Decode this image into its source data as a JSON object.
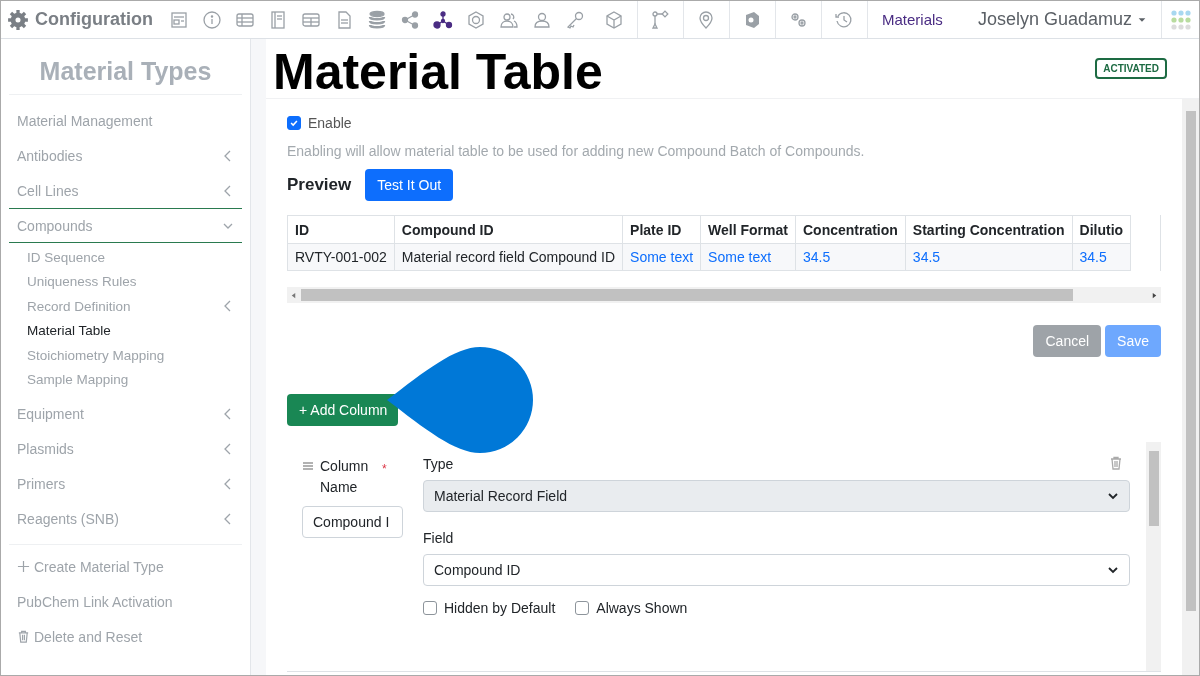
{
  "topbar": {
    "title": "Configuration",
    "icons": [
      {
        "kind": "form",
        "selected": false
      },
      {
        "kind": "info",
        "selected": false
      },
      {
        "kind": "table",
        "selected": false
      },
      {
        "kind": "book",
        "selected": false
      },
      {
        "kind": "grid",
        "selected": false
      },
      {
        "kind": "document",
        "selected": false
      },
      {
        "kind": "database",
        "selected": false
      },
      {
        "kind": "share",
        "selected": false
      },
      {
        "kind": "network",
        "selected": true
      },
      {
        "kind": "hexagon",
        "selected": false
      },
      {
        "kind": "users",
        "selected": false
      },
      {
        "kind": "user",
        "selected": false
      },
      {
        "kind": "key",
        "selected": false
      },
      {
        "kind": "cube",
        "selected": false
      },
      {
        "kind": "branch",
        "selected": false
      },
      {
        "kind": "pin",
        "selected": false
      },
      {
        "kind": "shield",
        "selected": false
      },
      {
        "kind": "gears",
        "selected": false
      },
      {
        "kind": "history",
        "selected": false
      }
    ],
    "link": "Materials",
    "user": "Joselyn Guadamuz"
  },
  "sidebar": {
    "title": "Material Types",
    "items": [
      {
        "label": "Material Management",
        "kind": "link"
      },
      {
        "label": "Antibodies",
        "kind": "group",
        "expanded": false
      },
      {
        "label": "Cell Lines",
        "kind": "group",
        "expanded": false
      },
      {
        "label": "Compounds",
        "kind": "group",
        "expanded": true,
        "children": [
          {
            "label": "ID Sequence",
            "kind": "link",
            "selected": false
          },
          {
            "label": "Uniqueness Rules",
            "kind": "link",
            "selected": false
          },
          {
            "label": "Record Definition",
            "kind": "group",
            "expanded": false,
            "selected": false
          },
          {
            "label": "Material Table",
            "kind": "link",
            "selected": true
          },
          {
            "label": "Stoichiometry Mapping",
            "kind": "link",
            "selected": false
          },
          {
            "label": "Sample Mapping",
            "kind": "link",
            "selected": false
          }
        ]
      },
      {
        "label": "Equipment",
        "kind": "group",
        "expanded": false
      },
      {
        "label": "Plasmids",
        "kind": "group",
        "expanded": false
      },
      {
        "label": "Primers",
        "kind": "group",
        "expanded": false
      },
      {
        "label": "Reagents (SNB)",
        "kind": "group",
        "expanded": false
      }
    ],
    "actions": [
      {
        "label": "Create Material Type",
        "kind": "create"
      },
      {
        "label": "PubChem Link Activation",
        "kind": "link"
      },
      {
        "label": "Delete and Reset",
        "kind": "delete"
      }
    ]
  },
  "main": {
    "title": "Material Table",
    "badge": "ACTIVATED",
    "enable": {
      "label": "Enable",
      "checked": true
    },
    "help": "Enabling will allow material table to be used for adding new Compound Batch of Compounds.",
    "preview_title": "Preview",
    "test_button": "Test It Out",
    "table": {
      "columns": [
        "ID",
        "Compound ID",
        "Plate ID",
        "Well Format",
        "Concentration",
        "Starting Concentration",
        "Dilutio"
      ],
      "rows": [
        [
          {
            "text": "RVTY-001-002",
            "kind": "text"
          },
          {
            "text": "Material record field Compound ID",
            "kind": "text"
          },
          {
            "text": "Some text",
            "kind": "link"
          },
          {
            "text": "Some text",
            "kind": "link"
          },
          {
            "text": "34.5",
            "kind": "link"
          },
          {
            "text": "34.5",
            "kind": "link"
          },
          {
            "text": "34.5",
            "kind": "link"
          }
        ]
      ]
    },
    "buttons": [
      {
        "label": "Cancel",
        "kind": "secondary",
        "disabled": false
      },
      {
        "label": "Save",
        "kind": "primary",
        "disabled": true
      }
    ],
    "add_button": "+ Add Column",
    "column_editor": {
      "name_label": "Column Name",
      "required_mark": "*",
      "name_value": "Compound I",
      "type_label": "Type",
      "type_value": "Material Record Field",
      "type_disabled": true,
      "field_label": "Field",
      "field_value": "Compound ID",
      "options": [
        {
          "label": "Hidden by Default",
          "checked": false
        },
        {
          "label": "Always Shown",
          "checked": false
        }
      ]
    }
  }
}
